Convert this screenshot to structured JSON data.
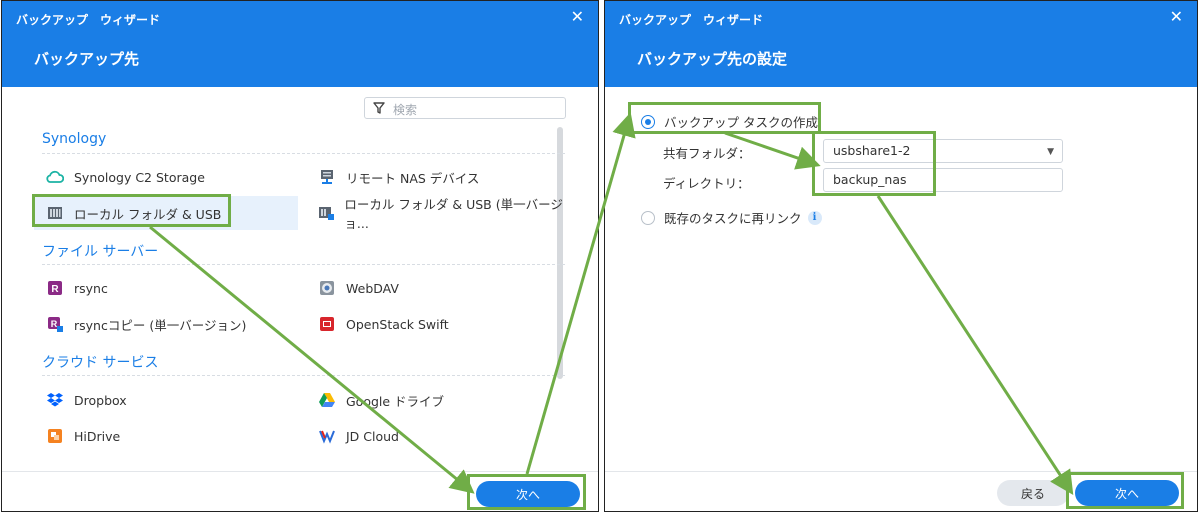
{
  "left_window": {
    "title": "バックアップ　ウィザード",
    "heading": "バックアップ先",
    "search_placeholder": "検索",
    "categories": [
      {
        "label": "Synology",
        "items": [
          {
            "label": "Synology C2 Storage",
            "icon": "cloud-icon"
          },
          {
            "label": "リモート NAS デバイス",
            "icon": "remote-nas-icon"
          },
          {
            "label": "ローカル フォルダ & USB",
            "icon": "local-nas-icon",
            "selected": true
          },
          {
            "label": "ローカル フォルダ & USB (単一バージョ...",
            "icon": "local-nas-single-icon"
          }
        ]
      },
      {
        "label": "ファイル サーバー",
        "items": [
          {
            "label": "rsync",
            "icon": "rsync-icon"
          },
          {
            "label": "WebDAV",
            "icon": "webdav-icon"
          },
          {
            "label": "rsyncコピー (単一バージョン)",
            "icon": "rsync-copy-icon"
          },
          {
            "label": "OpenStack Swift",
            "icon": "openstack-icon"
          }
        ]
      },
      {
        "label": "クラウド サービス",
        "items": [
          {
            "label": "Dropbox",
            "icon": "dropbox-icon"
          },
          {
            "label": "Google ドライブ",
            "icon": "google-drive-icon"
          },
          {
            "label": "HiDrive",
            "icon": "hidrive-icon"
          },
          {
            "label": "JD Cloud",
            "icon": "jd-cloud-icon"
          }
        ]
      }
    ],
    "next_label": "次へ"
  },
  "right_window": {
    "title": "バックアップ　ウィザード",
    "heading": "バックアップ先の設定",
    "option_create": "バックアップ タスクの作成",
    "shared_folder_label": "共有フォルダ：",
    "shared_folder_value": "usbshare1-2",
    "directory_label": "ディレクトリ：",
    "directory_value": "backup_nas",
    "option_relink": "既存のタスクに再リンク",
    "back_label": "戻る",
    "next_label": "次へ"
  },
  "colors": {
    "accent": "#1a7ee6",
    "annotation": "#70ad47"
  }
}
